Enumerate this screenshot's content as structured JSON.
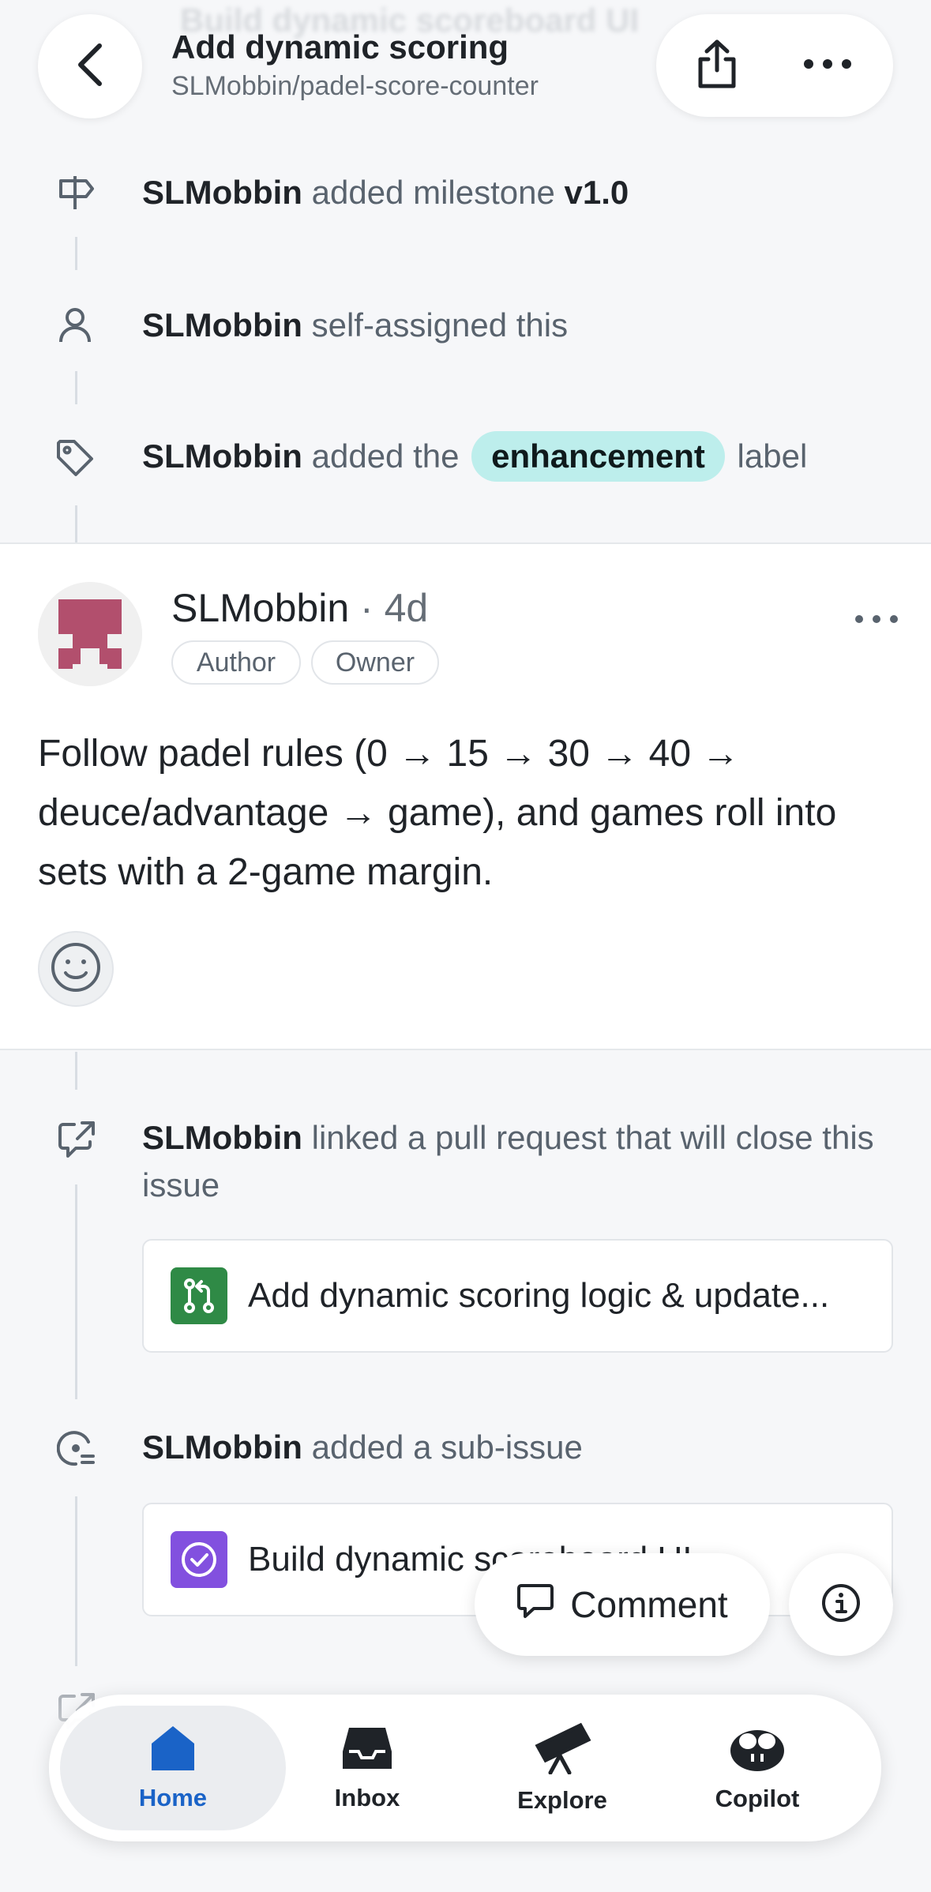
{
  "header": {
    "background_title": "Build dynamic scoreboard UI",
    "title": "Add dynamic scoring",
    "repo": "SLMobbin/padel-score-counter"
  },
  "timeline_top": [
    {
      "actor": "SLMobbin",
      "text": " added milestone ",
      "target": "v1.0",
      "icon": "milestone-icon"
    },
    {
      "actor": "SLMobbin",
      "text": " self-assigned this",
      "icon": "person-icon"
    },
    {
      "actor": "SLMobbin",
      "text_before": " added the ",
      "label": "enhancement",
      "text_after": " label",
      "icon": "tag-icon"
    }
  ],
  "comment": {
    "author": "SLMobbin",
    "time": " · 4d",
    "badges": [
      "Author",
      "Owner"
    ],
    "body": "Follow padel rules (0 → 15 → 30 → 40 → deuce/advantage → game), and games roll into sets with a 2-game margin."
  },
  "timeline_bottom": [
    {
      "actor": "SLMobbin",
      "text": " linked a pull request that will close this issue",
      "icon": "cross-reference-icon",
      "card": {
        "title": "Add dynamic scoring logic & update...",
        "color": "#2f8a46",
        "icon": "pull-request-icon"
      }
    },
    {
      "actor": "SLMobbin",
      "text": " added a sub-issue",
      "icon": "sub-issue-icon",
      "card": {
        "title": "Build dynamic scoreboard UI",
        "color": "#8250df",
        "icon": "issue-closed-icon"
      }
    }
  ],
  "actions": {
    "comment": "Comment"
  },
  "tabs": [
    {
      "label": "Home",
      "icon": "home-icon",
      "active": true
    },
    {
      "label": "Inbox",
      "icon": "inbox-icon"
    },
    {
      "label": "Explore",
      "icon": "telescope-icon"
    },
    {
      "label": "Copilot",
      "icon": "copilot-icon"
    }
  ],
  "colors": {
    "accent": "#1a63c7",
    "label_bg": "#bdeeec",
    "pr_green": "#2f8a46",
    "issue_purple": "#8250df"
  }
}
